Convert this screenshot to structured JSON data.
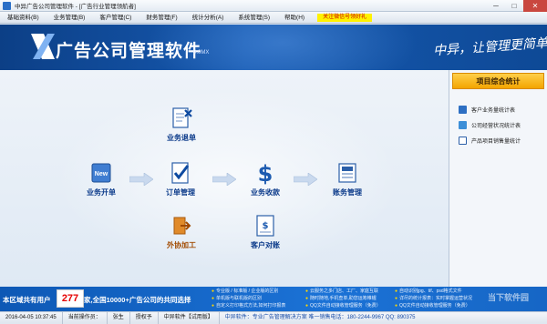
{
  "window": {
    "title": "中异广告公司管理软件 - [广告行业管理领航者]",
    "min": "─",
    "max": "□",
    "close": "✕"
  },
  "menu": {
    "items": [
      "基础资料(B)",
      "业务管理(B)",
      "客户管理(C)",
      "财务管理(F)",
      "统计分析(A)",
      "系统管理(S)",
      "帮助(H)"
    ],
    "highlight": "关注微信号领好礼"
  },
  "banner": {
    "title": "广告公司管理软件",
    "version": "9.0MX",
    "slogan": "中异，让管理更简单"
  },
  "workflow": {
    "return": "业务退单",
    "open": "业务开单",
    "order": "订单管理",
    "receipt": "业务收款",
    "ledger": "账务管理",
    "outsource": "外协加工",
    "reconcile": "客户对账",
    "new_badge": "New"
  },
  "right_panel": {
    "header": "项目综合统计",
    "items": [
      "客户业务量统计表",
      "公司经营状况统计表",
      "产品项目销售量统计"
    ]
  },
  "adstrip": {
    "left": "本区域共有用户",
    "count": "277",
    "right": "家,全国10000+广告公司的共同选择",
    "col1": [
      "专业版 / 标准版 / 企业版的区别",
      "单机版与联机版的区别",
      "自定义打印格式方法,如何打印报表"
    ],
    "col2": [
      "云服务之多门店、工厂、家庭互联",
      "随时随地,手机查单,助您运筹帷幄",
      "QQ文件自动接收管理服务（免费）"
    ],
    "col3": [
      "自动识别jpg、tif、psd格式文件",
      "详尽的统计报表：实时掌握运营状况",
      "QQ文件自动接收管理服务（免费）"
    ],
    "watermark": "当下软件园"
  },
  "status": {
    "datetime": "2016-04-05 10:37:45",
    "operator_label": "当前操作员：",
    "operator": "张生",
    "auth_label": "授权予",
    "edition": "中异软件【试用版】",
    "contact": "中异软件：专业广告管理解决方案  唯一销售电话：180-2244-9967  QQ: 890375"
  },
  "colors": {
    "banner": "#1659b0",
    "accent": "#f3a500",
    "workflow_label": "#0b3a8a",
    "count": "#e60000"
  }
}
